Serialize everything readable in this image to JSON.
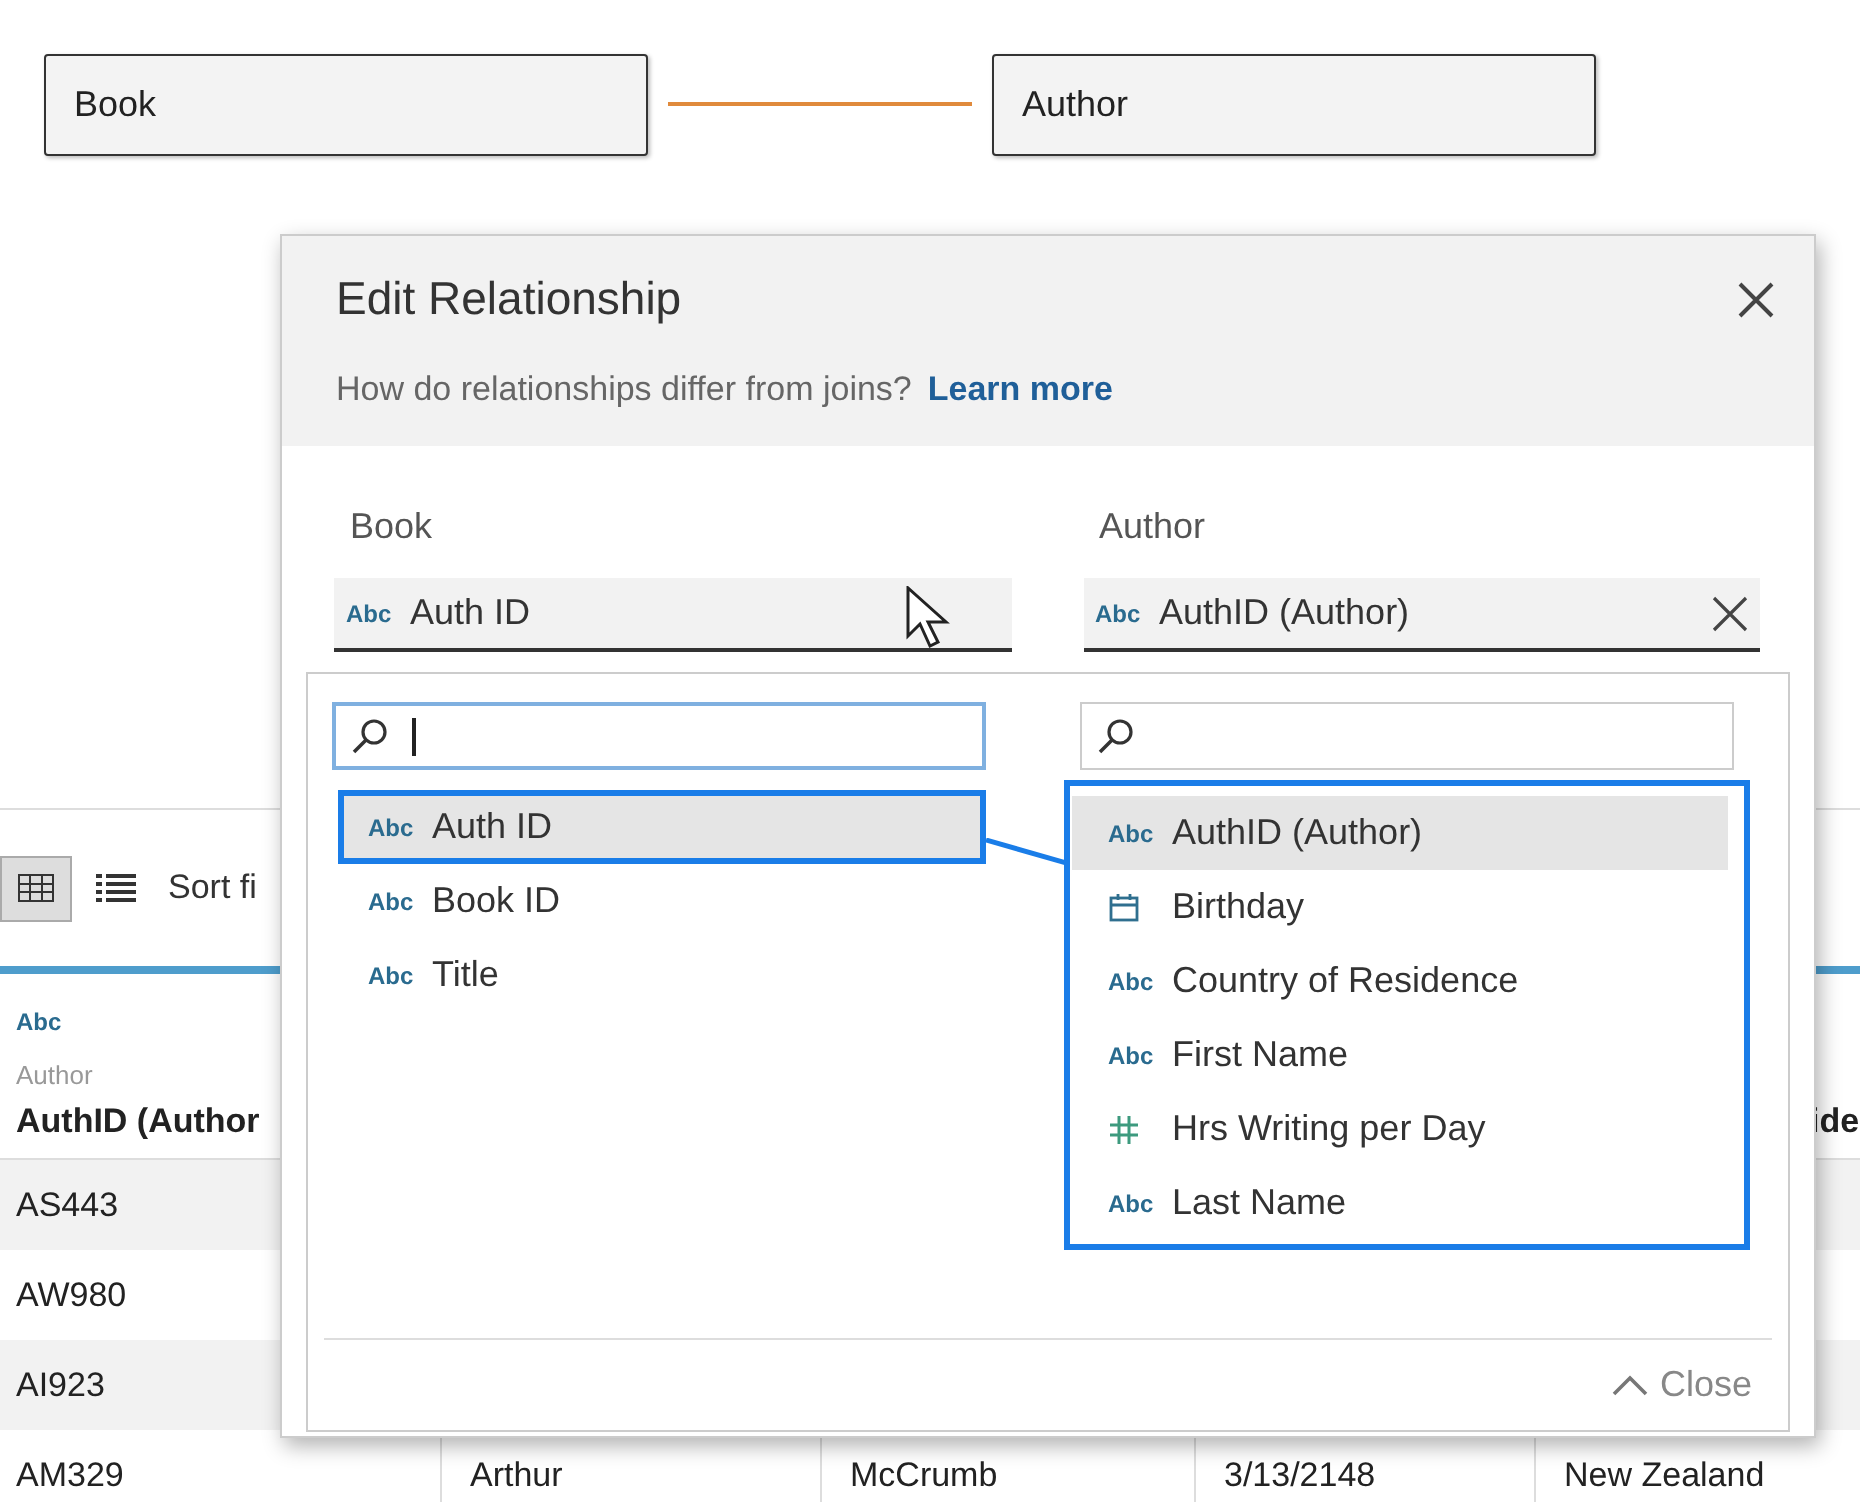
{
  "canvas": {
    "tables": [
      {
        "name": "Book"
      },
      {
        "name": "Author"
      }
    ]
  },
  "toolbar": {
    "views": [
      {
        "kind": "grid",
        "selected": true
      },
      {
        "kind": "list",
        "selected": false
      }
    ],
    "sort_label": "Sort fi"
  },
  "grid": {
    "columns": [
      {
        "type_label": "Abc",
        "source": "Author",
        "name": "AuthID (Author"
      },
      {
        "name": "ide"
      }
    ],
    "rows": [
      {
        "cells": [
          "AS443"
        ]
      },
      {
        "cells": [
          "AW980"
        ]
      },
      {
        "cells": [
          "AI923"
        ]
      },
      {
        "cells": [
          "AM329",
          "Arthur",
          "McCrumb",
          "3/13/2148",
          "New Zealand"
        ]
      }
    ]
  },
  "dialog": {
    "title": "Edit Relationship",
    "subtitle": "How do relationships differ from joins?",
    "link": "Learn more",
    "sides": [
      {
        "label": "Book",
        "field": {
          "type_label": "Abc",
          "name": "Auth ID"
        },
        "clearable": false
      },
      {
        "label": "Author",
        "field": {
          "type_label": "Abc",
          "name": "AuthID (Author)"
        },
        "clearable": true
      }
    ],
    "picker": {
      "annotated": true,
      "close_label": "Close",
      "lists": [
        {
          "search": {
            "focused": true
          },
          "items": [
            {
              "kind": "string",
              "type_label": "Abc",
              "name": "Auth ID",
              "selected": true
            },
            {
              "kind": "string",
              "type_label": "Abc",
              "name": "Book ID",
              "selected": false
            },
            {
              "kind": "string",
              "type_label": "Abc",
              "name": "Title",
              "selected": false
            }
          ]
        },
        {
          "search": {
            "focused": false
          },
          "items": [
            {
              "kind": "string",
              "type_label": "Abc",
              "name": "AuthID (Author)",
              "selected": true
            },
            {
              "kind": "date",
              "name": "Birthday",
              "selected": false
            },
            {
              "kind": "string",
              "type_label": "Abc",
              "name": "Country of Residence",
              "selected": false
            },
            {
              "kind": "string",
              "type_label": "Abc",
              "name": "First Name",
              "selected": false
            },
            {
              "kind": "number",
              "name": "Hrs Writing per Day",
              "selected": false
            },
            {
              "kind": "string",
              "type_label": "Abc",
              "name": "Last Name",
              "selected": false
            }
          ]
        }
      ]
    }
  }
}
